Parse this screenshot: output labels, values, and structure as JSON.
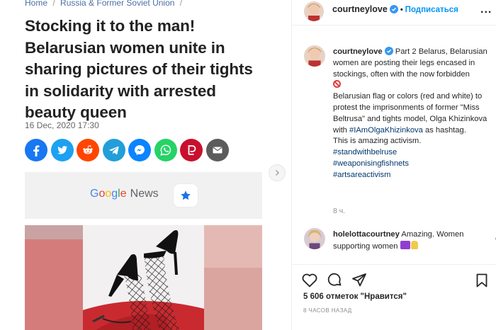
{
  "article": {
    "breadcrumb": [
      {
        "label": "Home"
      },
      {
        "label": "Russia & Former Soviet Union"
      }
    ],
    "breadcrumb_sep": "/",
    "headline": "Stocking it to the man! Belarusian women unite in sharing pictures of their tights in solidarity with arrested beauty queen",
    "date": "16 Dec, 2020 17:30",
    "share_buttons": [
      {
        "icon": "facebook-icon",
        "color": "#1877f2"
      },
      {
        "icon": "twitter-icon",
        "color": "#1da1f2"
      },
      {
        "icon": "reddit-icon",
        "color": "#ff4500"
      },
      {
        "icon": "telegram-icon",
        "color": "#229ed9"
      },
      {
        "icon": "messenger-icon",
        "color": "#0a84ff"
      },
      {
        "icon": "whatsapp-icon",
        "color": "#25d366"
      },
      {
        "icon": "parler-icon",
        "color": "#c8102e"
      },
      {
        "icon": "email-icon",
        "color": "#5b5b5b"
      }
    ],
    "google_news": {
      "google": "Google",
      "news": "News",
      "icon": "star-icon"
    }
  },
  "instagram": {
    "username": "courtneylove",
    "dot": "•",
    "follow_label": "Подписаться",
    "more": "...",
    "caption": {
      "user": "courtneylove",
      "line1": "Part 2 Belarus, Belarusian women are posting their legs encased in stockings, often with the now forbidden",
      "line2": "Belarusian flag or colors (red and white) to protest the imprisonments of former \"Miss Beltrusa\" and tights model, Olga Khizinkova with",
      "hashtag_inline": "#IAmOlgaKhizinkova",
      "line2_end": " as hashtag.",
      "line3": "This is amazing activism.",
      "hashtags": [
        "#standwithbelruse",
        "#weaponisingfishnets",
        "#artsareactivism"
      ]
    },
    "time": "8 ч.",
    "comment": {
      "user": "holelottacourtney",
      "text": "Amazing. Women supporting women"
    },
    "likes": "5 606 отметок \"Нравится\"",
    "ago": "8 ЧАСОВ НАЗАД",
    "colors": {
      "link": "#00376b",
      "follow": "#0095f6",
      "verified": "#3897f0"
    }
  }
}
